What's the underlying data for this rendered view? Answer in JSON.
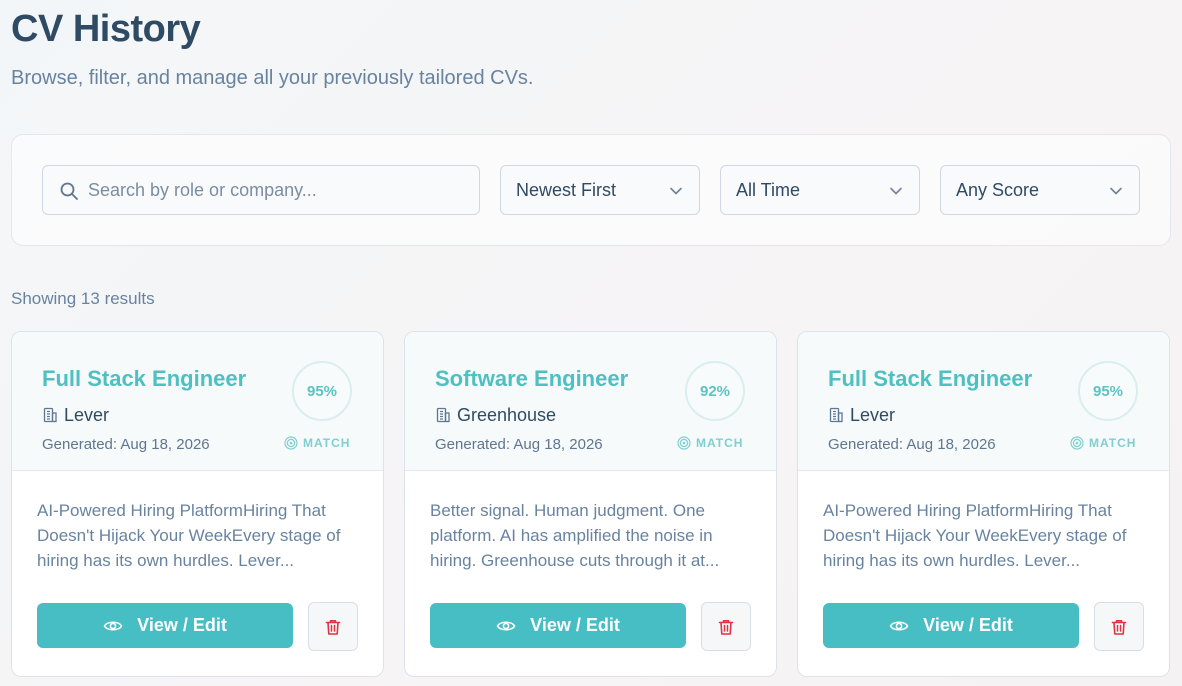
{
  "header": {
    "title": "CV History",
    "subtitle": "Browse, filter, and manage all your previously tailored CVs."
  },
  "filters": {
    "search": {
      "placeholder": "Search by role or company...",
      "value": ""
    },
    "sort": {
      "selected": "Newest First"
    },
    "time": {
      "selected": "All Time"
    },
    "score": {
      "selected": "Any Score"
    }
  },
  "results": {
    "summary": "Showing 13 results"
  },
  "cards": [
    {
      "title": "Full Stack Engineer",
      "company": "Lever",
      "generated": "Generated: Aug 18, 2026",
      "score": "95%",
      "match_label": "MATCH",
      "description": "AI-Powered Hiring PlatformHiring That Doesn't Hijack Your WeekEvery stage of hiring has its own hurdles. Lever...",
      "view_label": "View / Edit"
    },
    {
      "title": "Software Engineer",
      "company": "Greenhouse",
      "generated": "Generated: Aug 18, 2026",
      "score": "92%",
      "match_label": "MATCH",
      "description": "Better signal. Human judgment. One platform. AI has amplified the noise in hiring. Greenhouse cuts through it at...",
      "view_label": "View / Edit"
    },
    {
      "title": "Full Stack Engineer",
      "company": "Lever",
      "generated": "Generated: Aug 18, 2026",
      "score": "95%",
      "match_label": "MATCH",
      "description": "AI-Powered Hiring PlatformHiring That Doesn't Hijack Your WeekEvery stage of hiring has its own hurdles. Lever...",
      "view_label": "View / Edit"
    }
  ],
  "colors": {
    "accent": "#47bec3",
    "title_teal": "#4fc0c2",
    "heading": "#2f4a63",
    "muted": "#6883a0",
    "danger": "#e0323f"
  },
  "icons": [
    "search-icon",
    "chevron-down-icon",
    "building-icon",
    "target-icon",
    "eye-icon",
    "trash-icon"
  ]
}
